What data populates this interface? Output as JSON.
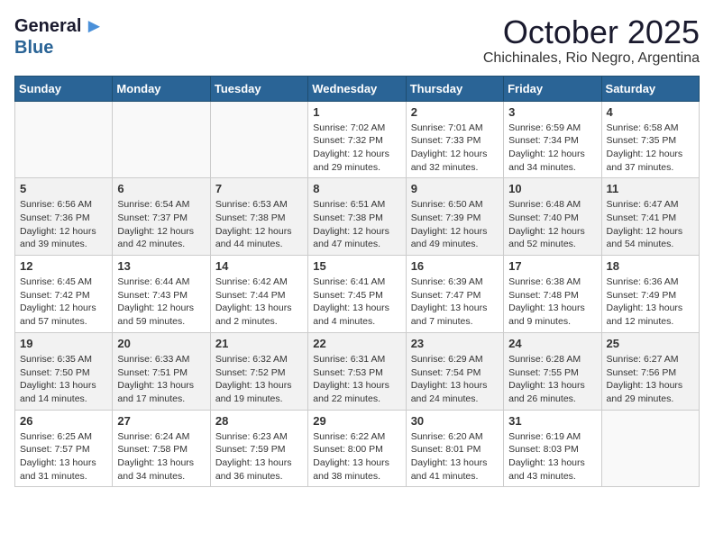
{
  "header": {
    "logo_line1": "General",
    "logo_line2": "Blue",
    "month": "October 2025",
    "location": "Chichinales, Rio Negro, Argentina"
  },
  "weekdays": [
    "Sunday",
    "Monday",
    "Tuesday",
    "Wednesday",
    "Thursday",
    "Friday",
    "Saturday"
  ],
  "weeks": [
    {
      "shaded": false,
      "days": [
        {
          "num": "",
          "detail": ""
        },
        {
          "num": "",
          "detail": ""
        },
        {
          "num": "",
          "detail": ""
        },
        {
          "num": "1",
          "detail": "Sunrise: 7:02 AM\nSunset: 7:32 PM\nDaylight: 12 hours\nand 29 minutes."
        },
        {
          "num": "2",
          "detail": "Sunrise: 7:01 AM\nSunset: 7:33 PM\nDaylight: 12 hours\nand 32 minutes."
        },
        {
          "num": "3",
          "detail": "Sunrise: 6:59 AM\nSunset: 7:34 PM\nDaylight: 12 hours\nand 34 minutes."
        },
        {
          "num": "4",
          "detail": "Sunrise: 6:58 AM\nSunset: 7:35 PM\nDaylight: 12 hours\nand 37 minutes."
        }
      ]
    },
    {
      "shaded": true,
      "days": [
        {
          "num": "5",
          "detail": "Sunrise: 6:56 AM\nSunset: 7:36 PM\nDaylight: 12 hours\nand 39 minutes."
        },
        {
          "num": "6",
          "detail": "Sunrise: 6:54 AM\nSunset: 7:37 PM\nDaylight: 12 hours\nand 42 minutes."
        },
        {
          "num": "7",
          "detail": "Sunrise: 6:53 AM\nSunset: 7:38 PM\nDaylight: 12 hours\nand 44 minutes."
        },
        {
          "num": "8",
          "detail": "Sunrise: 6:51 AM\nSunset: 7:38 PM\nDaylight: 12 hours\nand 47 minutes."
        },
        {
          "num": "9",
          "detail": "Sunrise: 6:50 AM\nSunset: 7:39 PM\nDaylight: 12 hours\nand 49 minutes."
        },
        {
          "num": "10",
          "detail": "Sunrise: 6:48 AM\nSunset: 7:40 PM\nDaylight: 12 hours\nand 52 minutes."
        },
        {
          "num": "11",
          "detail": "Sunrise: 6:47 AM\nSunset: 7:41 PM\nDaylight: 12 hours\nand 54 minutes."
        }
      ]
    },
    {
      "shaded": false,
      "days": [
        {
          "num": "12",
          "detail": "Sunrise: 6:45 AM\nSunset: 7:42 PM\nDaylight: 12 hours\nand 57 minutes."
        },
        {
          "num": "13",
          "detail": "Sunrise: 6:44 AM\nSunset: 7:43 PM\nDaylight: 12 hours\nand 59 minutes."
        },
        {
          "num": "14",
          "detail": "Sunrise: 6:42 AM\nSunset: 7:44 PM\nDaylight: 13 hours\nand 2 minutes."
        },
        {
          "num": "15",
          "detail": "Sunrise: 6:41 AM\nSunset: 7:45 PM\nDaylight: 13 hours\nand 4 minutes."
        },
        {
          "num": "16",
          "detail": "Sunrise: 6:39 AM\nSunset: 7:47 PM\nDaylight: 13 hours\nand 7 minutes."
        },
        {
          "num": "17",
          "detail": "Sunrise: 6:38 AM\nSunset: 7:48 PM\nDaylight: 13 hours\nand 9 minutes."
        },
        {
          "num": "18",
          "detail": "Sunrise: 6:36 AM\nSunset: 7:49 PM\nDaylight: 13 hours\nand 12 minutes."
        }
      ]
    },
    {
      "shaded": true,
      "days": [
        {
          "num": "19",
          "detail": "Sunrise: 6:35 AM\nSunset: 7:50 PM\nDaylight: 13 hours\nand 14 minutes."
        },
        {
          "num": "20",
          "detail": "Sunrise: 6:33 AM\nSunset: 7:51 PM\nDaylight: 13 hours\nand 17 minutes."
        },
        {
          "num": "21",
          "detail": "Sunrise: 6:32 AM\nSunset: 7:52 PM\nDaylight: 13 hours\nand 19 minutes."
        },
        {
          "num": "22",
          "detail": "Sunrise: 6:31 AM\nSunset: 7:53 PM\nDaylight: 13 hours\nand 22 minutes."
        },
        {
          "num": "23",
          "detail": "Sunrise: 6:29 AM\nSunset: 7:54 PM\nDaylight: 13 hours\nand 24 minutes."
        },
        {
          "num": "24",
          "detail": "Sunrise: 6:28 AM\nSunset: 7:55 PM\nDaylight: 13 hours\nand 26 minutes."
        },
        {
          "num": "25",
          "detail": "Sunrise: 6:27 AM\nSunset: 7:56 PM\nDaylight: 13 hours\nand 29 minutes."
        }
      ]
    },
    {
      "shaded": false,
      "days": [
        {
          "num": "26",
          "detail": "Sunrise: 6:25 AM\nSunset: 7:57 PM\nDaylight: 13 hours\nand 31 minutes."
        },
        {
          "num": "27",
          "detail": "Sunrise: 6:24 AM\nSunset: 7:58 PM\nDaylight: 13 hours\nand 34 minutes."
        },
        {
          "num": "28",
          "detail": "Sunrise: 6:23 AM\nSunset: 7:59 PM\nDaylight: 13 hours\nand 36 minutes."
        },
        {
          "num": "29",
          "detail": "Sunrise: 6:22 AM\nSunset: 8:00 PM\nDaylight: 13 hours\nand 38 minutes."
        },
        {
          "num": "30",
          "detail": "Sunrise: 6:20 AM\nSunset: 8:01 PM\nDaylight: 13 hours\nand 41 minutes."
        },
        {
          "num": "31",
          "detail": "Sunrise: 6:19 AM\nSunset: 8:03 PM\nDaylight: 13 hours\nand 43 minutes."
        },
        {
          "num": "",
          "detail": ""
        }
      ]
    }
  ]
}
